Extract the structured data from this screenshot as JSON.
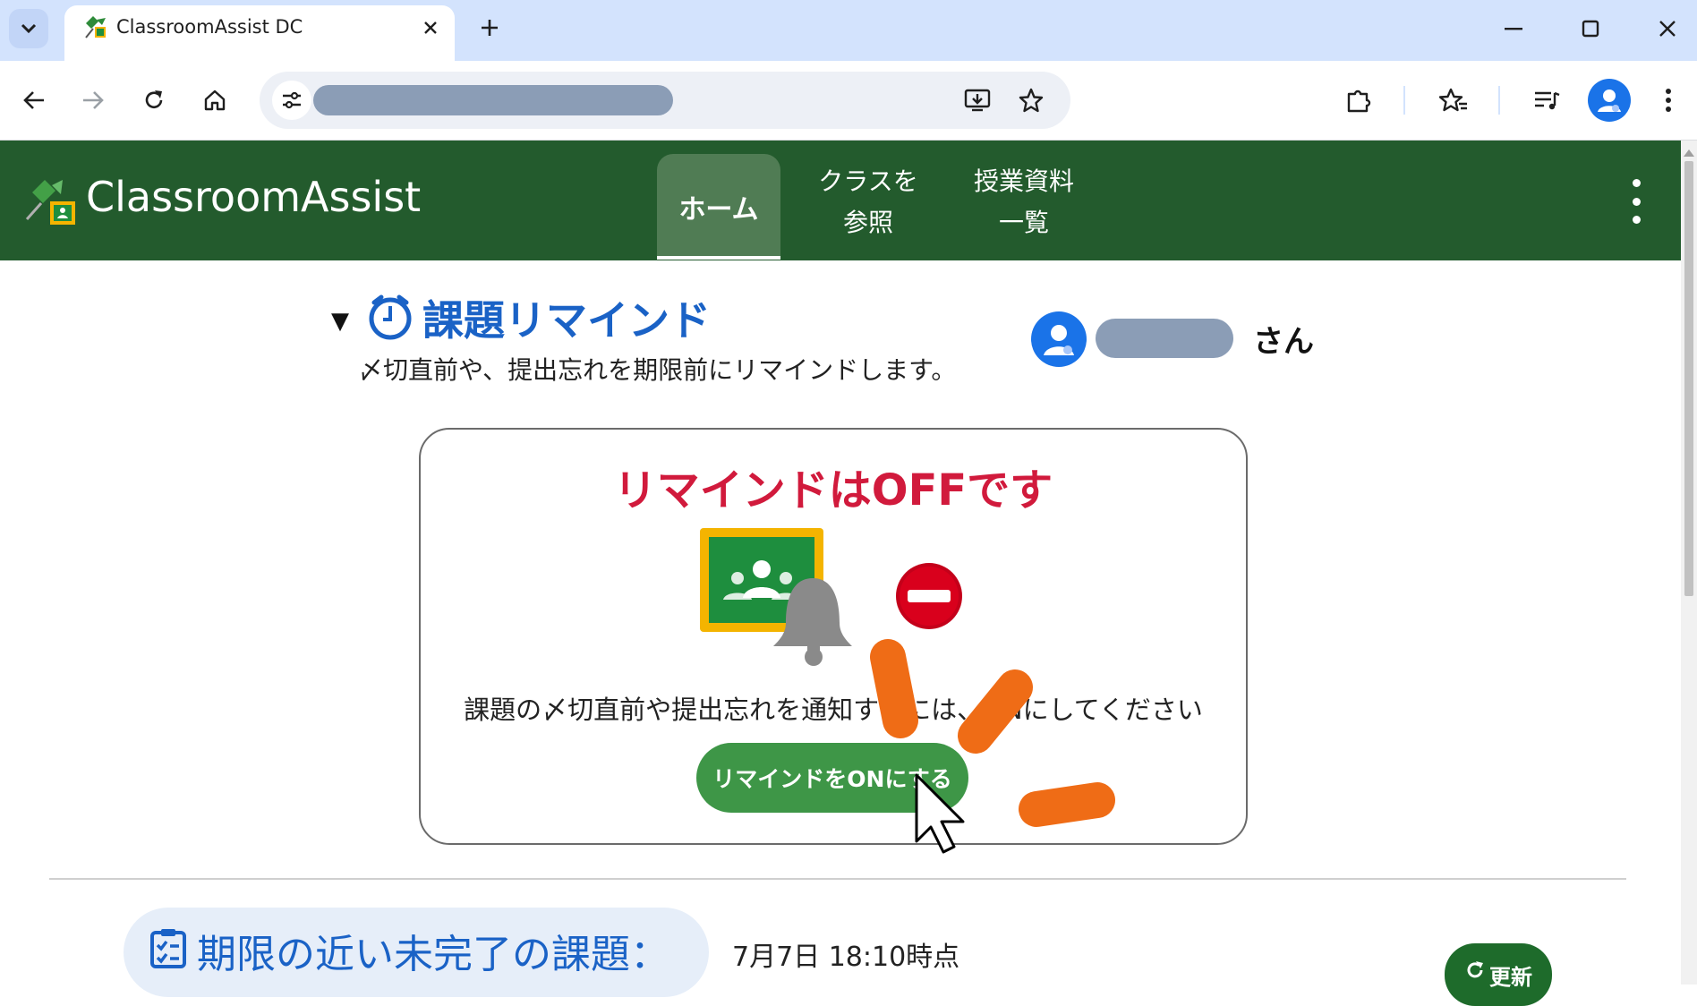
{
  "browser": {
    "tab_title": "ClassroomAssist DC",
    "tab_favicon": "classroomassist-favicon",
    "icons": {
      "tab_search": "chevron-down-icon",
      "tab_close": "close-icon",
      "new_tab": "plus-icon",
      "minimize": "minimize-icon",
      "maximize": "maximize-icon",
      "close": "close-icon",
      "back": "arrow-left-icon",
      "forward": "arrow-right-icon",
      "reload": "reload-icon",
      "home": "home-icon",
      "site_info": "tune-icon",
      "install": "install-icon",
      "bookmark": "star-icon",
      "extensions": "puzzle-icon",
      "bookmarks_manager": "star-list-icon",
      "media": "media-queue-icon",
      "profile": "avatar-icon",
      "menu": "vertical-dots-icon"
    }
  },
  "app": {
    "title": "ClassroomAssist",
    "nav": {
      "home": "ホーム",
      "classes_line1": "クラスを",
      "classes_line2": "参照",
      "materials_line1": "授業資料",
      "materials_line2": "一覧"
    }
  },
  "reminder": {
    "toggle": "▼",
    "title": "課題リマインド",
    "description": "〆切直前や、提出忘れを期限前にリマインドします。",
    "user_suffix": "さん",
    "status_title": "リマインドはOFFです",
    "hint": "課題の〆切直前や提出忘れを通知するには、ONにしてください",
    "enable_button": "リマインドをONにする"
  },
  "tasks": {
    "title": "期限の近い未完了の課題：",
    "timestamp": "7月7日 18:10時点",
    "refresh_button": "更新"
  },
  "colors": {
    "header_green": "#235b2d",
    "title_blue": "#1a62c6",
    "status_red": "#d11a3c",
    "button_green": "#3e9647",
    "annotation_orange": "#ef6c16"
  }
}
